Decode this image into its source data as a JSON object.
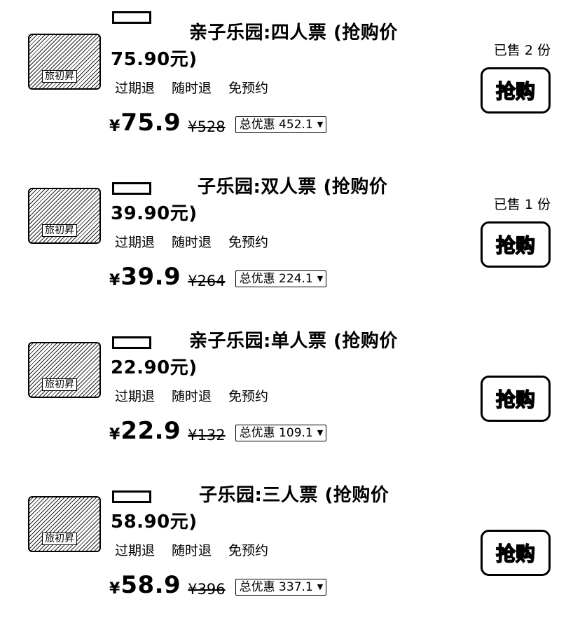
{
  "items": [
    {
      "title_line1": "亲子乐园:四人票 (抢购价",
      "title_line2": "75.90元)",
      "tags": [
        "过期退",
        "随时退",
        "免预约"
      ],
      "currency": "¥",
      "price": "75.9",
      "original_price": "¥528",
      "discount": "总优惠 452.1",
      "sold": "已售 2 份",
      "button": "抢购",
      "thumb_label": "旅初昇"
    },
    {
      "title_line1": "子乐园:双人票 (抢购价",
      "title_line2": "39.90元)",
      "tags": [
        "过期退",
        "随时退",
        "免预约"
      ],
      "currency": "¥",
      "price": "39.9",
      "original_price": "¥264",
      "discount": "总优惠 224.1",
      "sold": "已售 1 份",
      "button": "抢购",
      "thumb_label": "旅初昇"
    },
    {
      "title_line1": "亲子乐园:单人票 (抢购价",
      "title_line2": "22.90元)",
      "tags": [
        "过期退",
        "随时退",
        "免预约"
      ],
      "currency": "¥",
      "price": "22.9",
      "original_price": "¥132",
      "discount": "总优惠 109.1",
      "sold": "",
      "button": "抢购",
      "thumb_label": "旅初昇"
    },
    {
      "title_line1": "子乐园:三人票 (抢购价",
      "title_line2": "58.90元)",
      "tags": [
        "过期退",
        "随时退",
        "免预约"
      ],
      "currency": "¥",
      "price": "58.9",
      "original_price": "¥396",
      "discount": "总优惠 337.1",
      "sold": "",
      "button": "抢购",
      "thumb_label": "旅初昇"
    }
  ]
}
